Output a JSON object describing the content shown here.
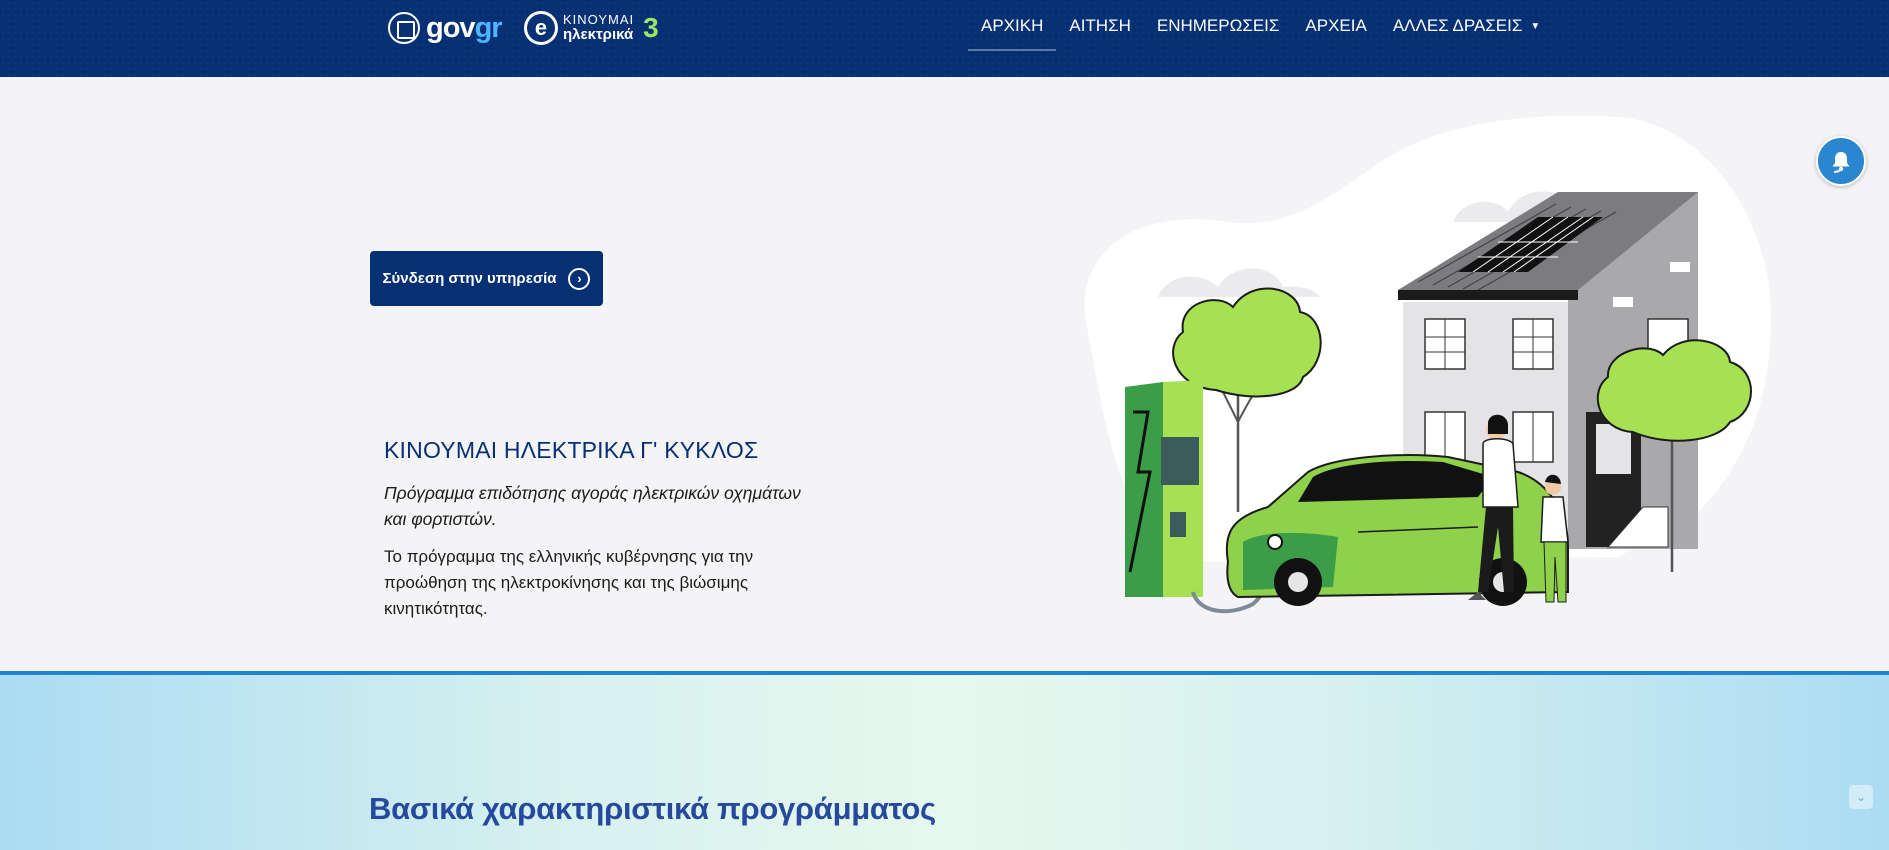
{
  "header": {
    "gov_logo": {
      "text_main": "gov",
      "text_accent": "gr"
    },
    "program_logo": {
      "line1": "ΚΙΝΟΥΜΑΙ",
      "line2": "ηλεκτρικά",
      "number": "3"
    },
    "nav": [
      {
        "label": "ΑΡΧΙΚΗ",
        "active": true
      },
      {
        "label": "ΑΙΤΗΣΗ"
      },
      {
        "label": "ΕΝΗΜΕΡΩΣΕΙΣ"
      },
      {
        "label": "ΑΡΧΕΙΑ"
      },
      {
        "label": "ΑΛΛΕΣ ΔΡΑΣΕΙΣ",
        "dropdown": true
      }
    ]
  },
  "hero": {
    "login_label": "Σύνδεση στην υπηρεσία",
    "title": "ΚΙΝΟΥΜΑΙ ΗΛΕΚΤΡΙΚΑ Γ' ΚΥΚΛΟΣ",
    "subtitle": "Πρόγραμμα επιδότησης αγοράς ηλεκτρικών οχημάτων και φορτιστών.",
    "description": "Το πρόγραμμα της ελληνικής κυβέρνησης για την προώθηση της ηλεκτροκίνησης και της βιώσιμης κινητικότητας."
  },
  "features": {
    "title": "Βασικά χαρακτηριστικά προγράμματος"
  },
  "colors": {
    "header_bg": "#063074",
    "primary": "#063074",
    "accent_green": "#9be564",
    "divider": "#1f85d1",
    "features_title": "#27499d",
    "bell": "#2a86cf"
  }
}
